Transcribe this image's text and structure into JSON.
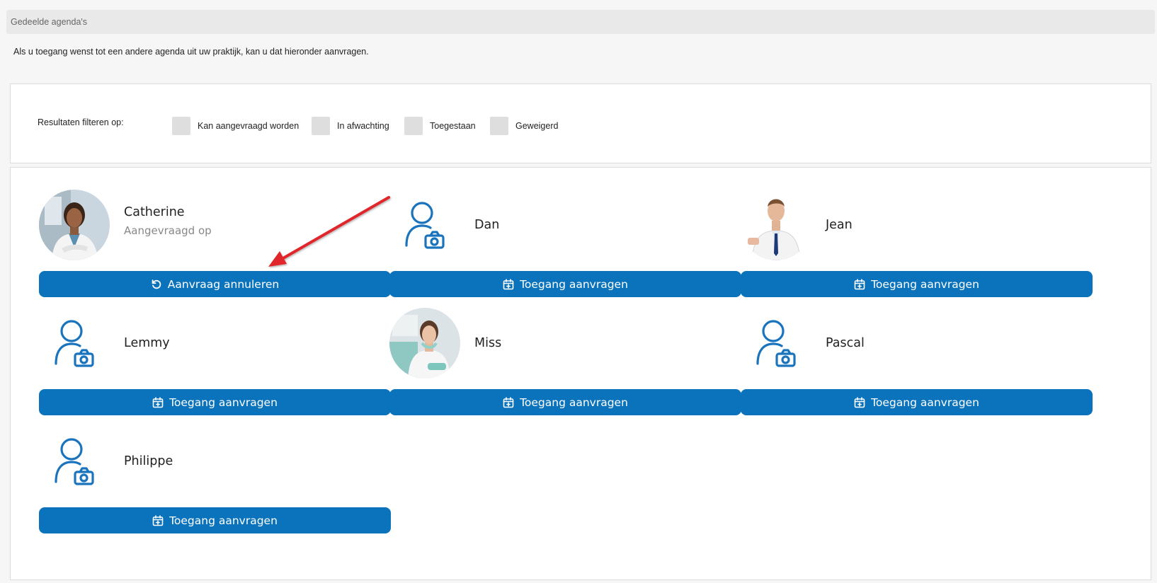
{
  "header": {
    "title": "Gedeelde agenda's"
  },
  "intro": {
    "text": "Als u toegang wenst tot een andere agenda uit uw praktijk, kan u dat hieronder aanvragen."
  },
  "filters": {
    "label": "Resultaten filteren op:",
    "options": [
      {
        "label": "Kan aangevraagd worden"
      },
      {
        "label": "In afwachting"
      },
      {
        "label": "Toegestaan"
      },
      {
        "label": "Geweigerd"
      }
    ]
  },
  "colors": {
    "accent": "#0b73bb",
    "icon_blue": "#1a74bd",
    "arrow": "#e0262b"
  },
  "cards": [
    {
      "name": "Catherine",
      "subtitle": "Aangevraagd op",
      "avatar": "photo-woman-doctor",
      "button_label": "Aanvraag annuleren",
      "button_icon": "undo-icon"
    },
    {
      "name": "Dan",
      "avatar": "user-camera-icon",
      "button_label": "Toegang aanvragen",
      "button_icon": "calendar-plus-icon"
    },
    {
      "name": "Jean",
      "avatar": "photo-man-doctor",
      "button_label": "Toegang aanvragen",
      "button_icon": "calendar-plus-icon"
    },
    {
      "name": "Lemmy",
      "avatar": "user-camera-icon",
      "button_label": "Toegang aanvragen",
      "button_icon": "calendar-plus-icon"
    },
    {
      "name": "Miss",
      "avatar": "photo-woman-dentist",
      "button_label": "Toegang aanvragen",
      "button_icon": "calendar-plus-icon"
    },
    {
      "name": "Pascal",
      "avatar": "user-camera-icon",
      "button_label": "Toegang aanvragen",
      "button_icon": "calendar-plus-icon"
    },
    {
      "name": "Philippe",
      "avatar": "user-camera-icon",
      "button_label": "Toegang aanvragen",
      "button_icon": "calendar-plus-icon"
    }
  ]
}
